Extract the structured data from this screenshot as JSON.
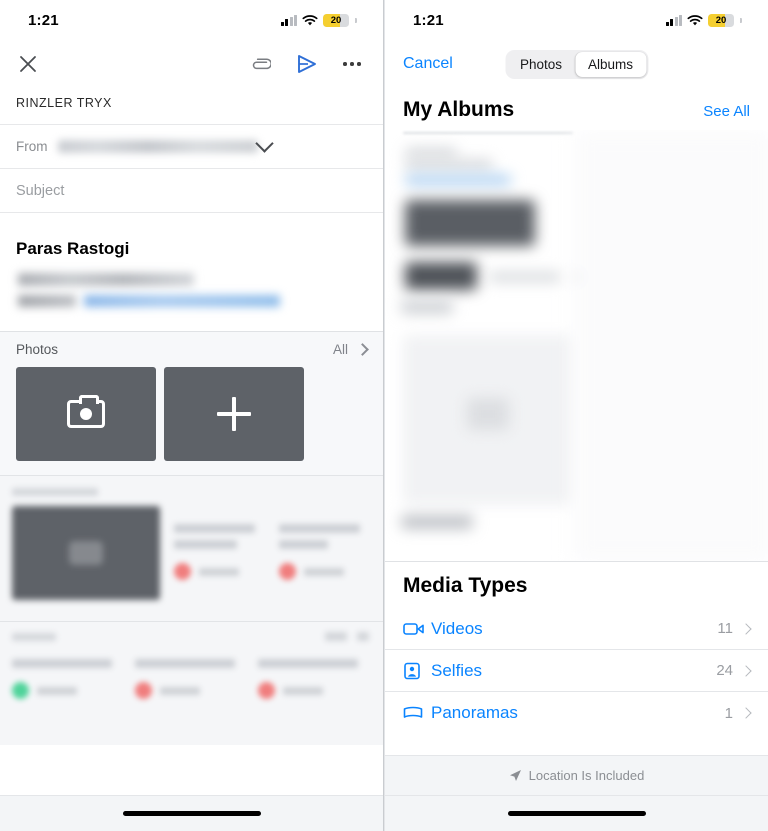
{
  "status_bar": {
    "time": "1:21",
    "battery_level": "20",
    "battery_color": "#f5cf30",
    "signal_icon": "cellular-signal-icon",
    "wifi_icon": "wifi-icon",
    "battery_icon": "battery-icon"
  },
  "compose": {
    "toolbar": {
      "close_icon": "close-icon",
      "attach_icon": "paperclip-icon",
      "send_icon": "send-icon",
      "more_icon": "more-options-icon",
      "send_color": "#2f6fd6"
    },
    "account_label": "RINZLER TRYX",
    "from": {
      "label": "From",
      "value": "",
      "chevron_icon": "chevron-down-icon"
    },
    "subject": {
      "label": "Subject",
      "placeholder": "Subject",
      "value": ""
    },
    "signature_name": "Paras Rastogi"
  },
  "photos_strip": {
    "title": "Photos",
    "all_label": "All",
    "chevron_icon": "chevron-right-icon",
    "tiles": [
      {
        "name": "camera-tile",
        "icon": "camera-icon"
      },
      {
        "name": "add-photo-tile",
        "icon": "plus-icon"
      }
    ]
  },
  "picker": {
    "cancel_label": "Cancel",
    "segments": [
      {
        "label": "Photos",
        "active": false
      },
      {
        "label": "Albums",
        "active": true
      }
    ],
    "my_albums": {
      "title": "My Albums",
      "see_all_label": "See All"
    },
    "media_types": {
      "title": "Media Types",
      "rows": [
        {
          "label": "Videos",
          "count": "11",
          "icon": "video-camera-icon"
        },
        {
          "label": "Selfies",
          "count": "24",
          "icon": "selfie-person-icon"
        },
        {
          "label": "Panoramas",
          "count": "1",
          "icon": "panorama-icon"
        }
      ]
    },
    "location_notice": {
      "text": "Location Is Included",
      "icon": "location-arrow-icon"
    }
  },
  "accent_colors": {
    "link_blue": "#0a84ff",
    "tile_gray": "#5e6268",
    "panel_gray": "#f7f8fa"
  }
}
